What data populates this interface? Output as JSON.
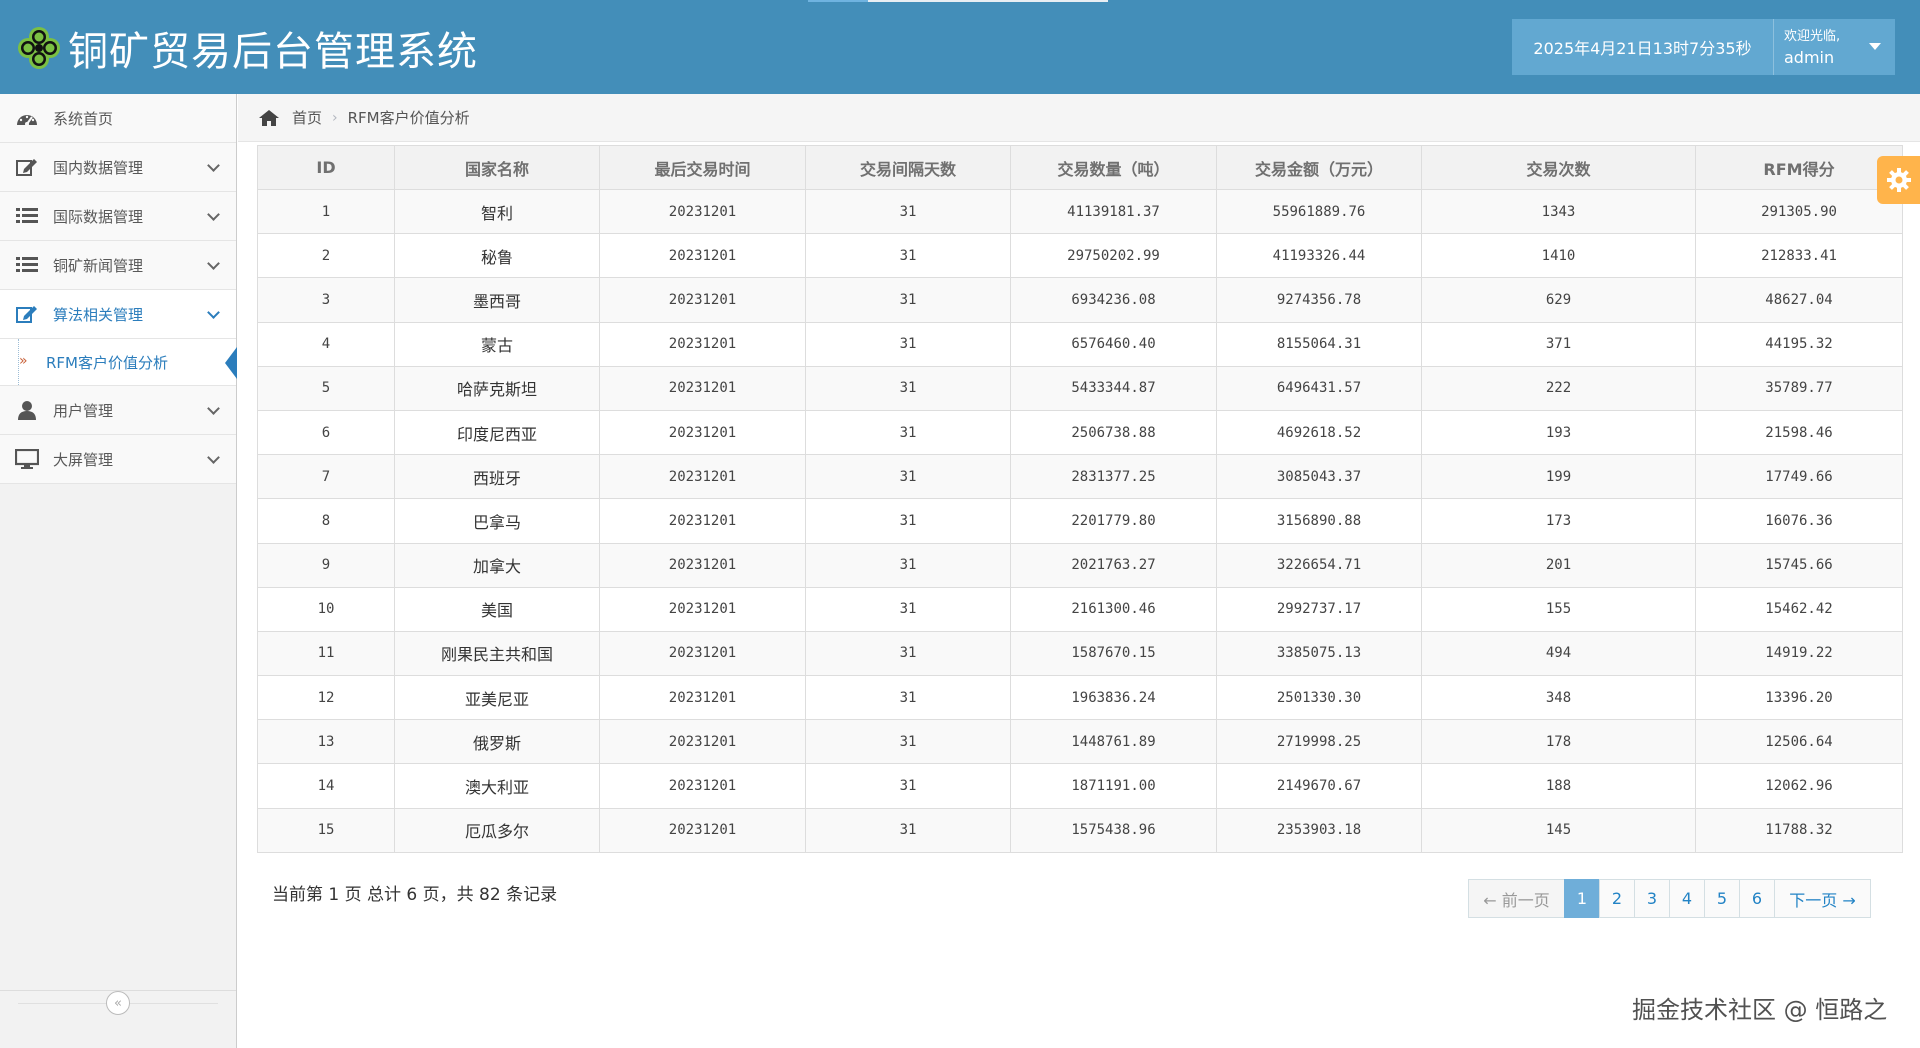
{
  "header": {
    "title": "铜矿贸易后台管理系统",
    "datetime": "2025年4月21日13时7分35秒",
    "welcome": "欢迎光临,",
    "username": "admin"
  },
  "sidebar": {
    "items": [
      {
        "label": "系统首页",
        "icon": "dashboard-icon"
      },
      {
        "label": "国内数据管理",
        "icon": "edit-icon"
      },
      {
        "label": "国际数据管理",
        "icon": "list-icon"
      },
      {
        "label": "铜矿新闻管理",
        "icon": "list-icon"
      },
      {
        "label": "算法相关管理",
        "icon": "edit-icon"
      },
      {
        "label": "用户管理",
        "icon": "user-icon"
      },
      {
        "label": "大屏管理",
        "icon": "desktop-icon"
      }
    ],
    "sub_item": {
      "label": "RFM客户价值分析"
    },
    "collapse_icon": "double-chevron-left-icon"
  },
  "breadcrumb": {
    "home": "首页",
    "current": "RFM客户价值分析"
  },
  "table": {
    "columns": [
      "ID",
      "国家名称",
      "最后交易时间",
      "交易间隔天数",
      "交易数量（吨）",
      "交易金额（万元）",
      "交易次数",
      "RFM得分"
    ],
    "rows": [
      [
        "1",
        "智利",
        "20231201",
        "31",
        "41139181.37",
        "55961889.76",
        "1343",
        "291305.90"
      ],
      [
        "2",
        "秘鲁",
        "20231201",
        "31",
        "29750202.99",
        "41193326.44",
        "1410",
        "212833.41"
      ],
      [
        "3",
        "墨西哥",
        "20231201",
        "31",
        "6934236.08",
        "9274356.78",
        "629",
        "48627.04"
      ],
      [
        "4",
        "蒙古",
        "20231201",
        "31",
        "6576460.40",
        "8155064.31",
        "371",
        "44195.32"
      ],
      [
        "5",
        "哈萨克斯坦",
        "20231201",
        "31",
        "5433344.87",
        "6496431.57",
        "222",
        "35789.77"
      ],
      [
        "6",
        "印度尼西亚",
        "20231201",
        "31",
        "2506738.88",
        "4692618.52",
        "193",
        "21598.46"
      ],
      [
        "7",
        "西班牙",
        "20231201",
        "31",
        "2831377.25",
        "3085043.37",
        "199",
        "17749.66"
      ],
      [
        "8",
        "巴拿马",
        "20231201",
        "31",
        "2201779.80",
        "3156890.88",
        "173",
        "16076.36"
      ],
      [
        "9",
        "加拿大",
        "20231201",
        "31",
        "2021763.27",
        "3226654.71",
        "201",
        "15745.66"
      ],
      [
        "10",
        "美国",
        "20231201",
        "31",
        "2161300.46",
        "2992737.17",
        "155",
        "15462.42"
      ],
      [
        "11",
        "刚果民主共和国",
        "20231201",
        "31",
        "1587670.15",
        "3385075.13",
        "494",
        "14919.22"
      ],
      [
        "12",
        "亚美尼亚",
        "20231201",
        "31",
        "1963836.24",
        "2501330.30",
        "348",
        "13396.20"
      ],
      [
        "13",
        "俄罗斯",
        "20231201",
        "31",
        "1448761.89",
        "2719998.25",
        "178",
        "12506.64"
      ],
      [
        "14",
        "澳大利亚",
        "20231201",
        "31",
        "1871191.00",
        "2149670.67",
        "188",
        "12062.96"
      ],
      [
        "15",
        "厄瓜多尔",
        "20231201",
        "31",
        "1575438.96",
        "2353903.18",
        "145",
        "11788.32"
      ]
    ]
  },
  "pagination": {
    "info": "当前第 1 页 总计 6 页，共 82 条记录",
    "prev": "← 前一页",
    "pages": [
      "1",
      "2",
      "3",
      "4",
      "5",
      "6"
    ],
    "active_page": "1",
    "next": "下一页 →"
  },
  "settings_icon": "gear-icon",
  "watermark": "掘金技术社区 @ 恒路之"
}
